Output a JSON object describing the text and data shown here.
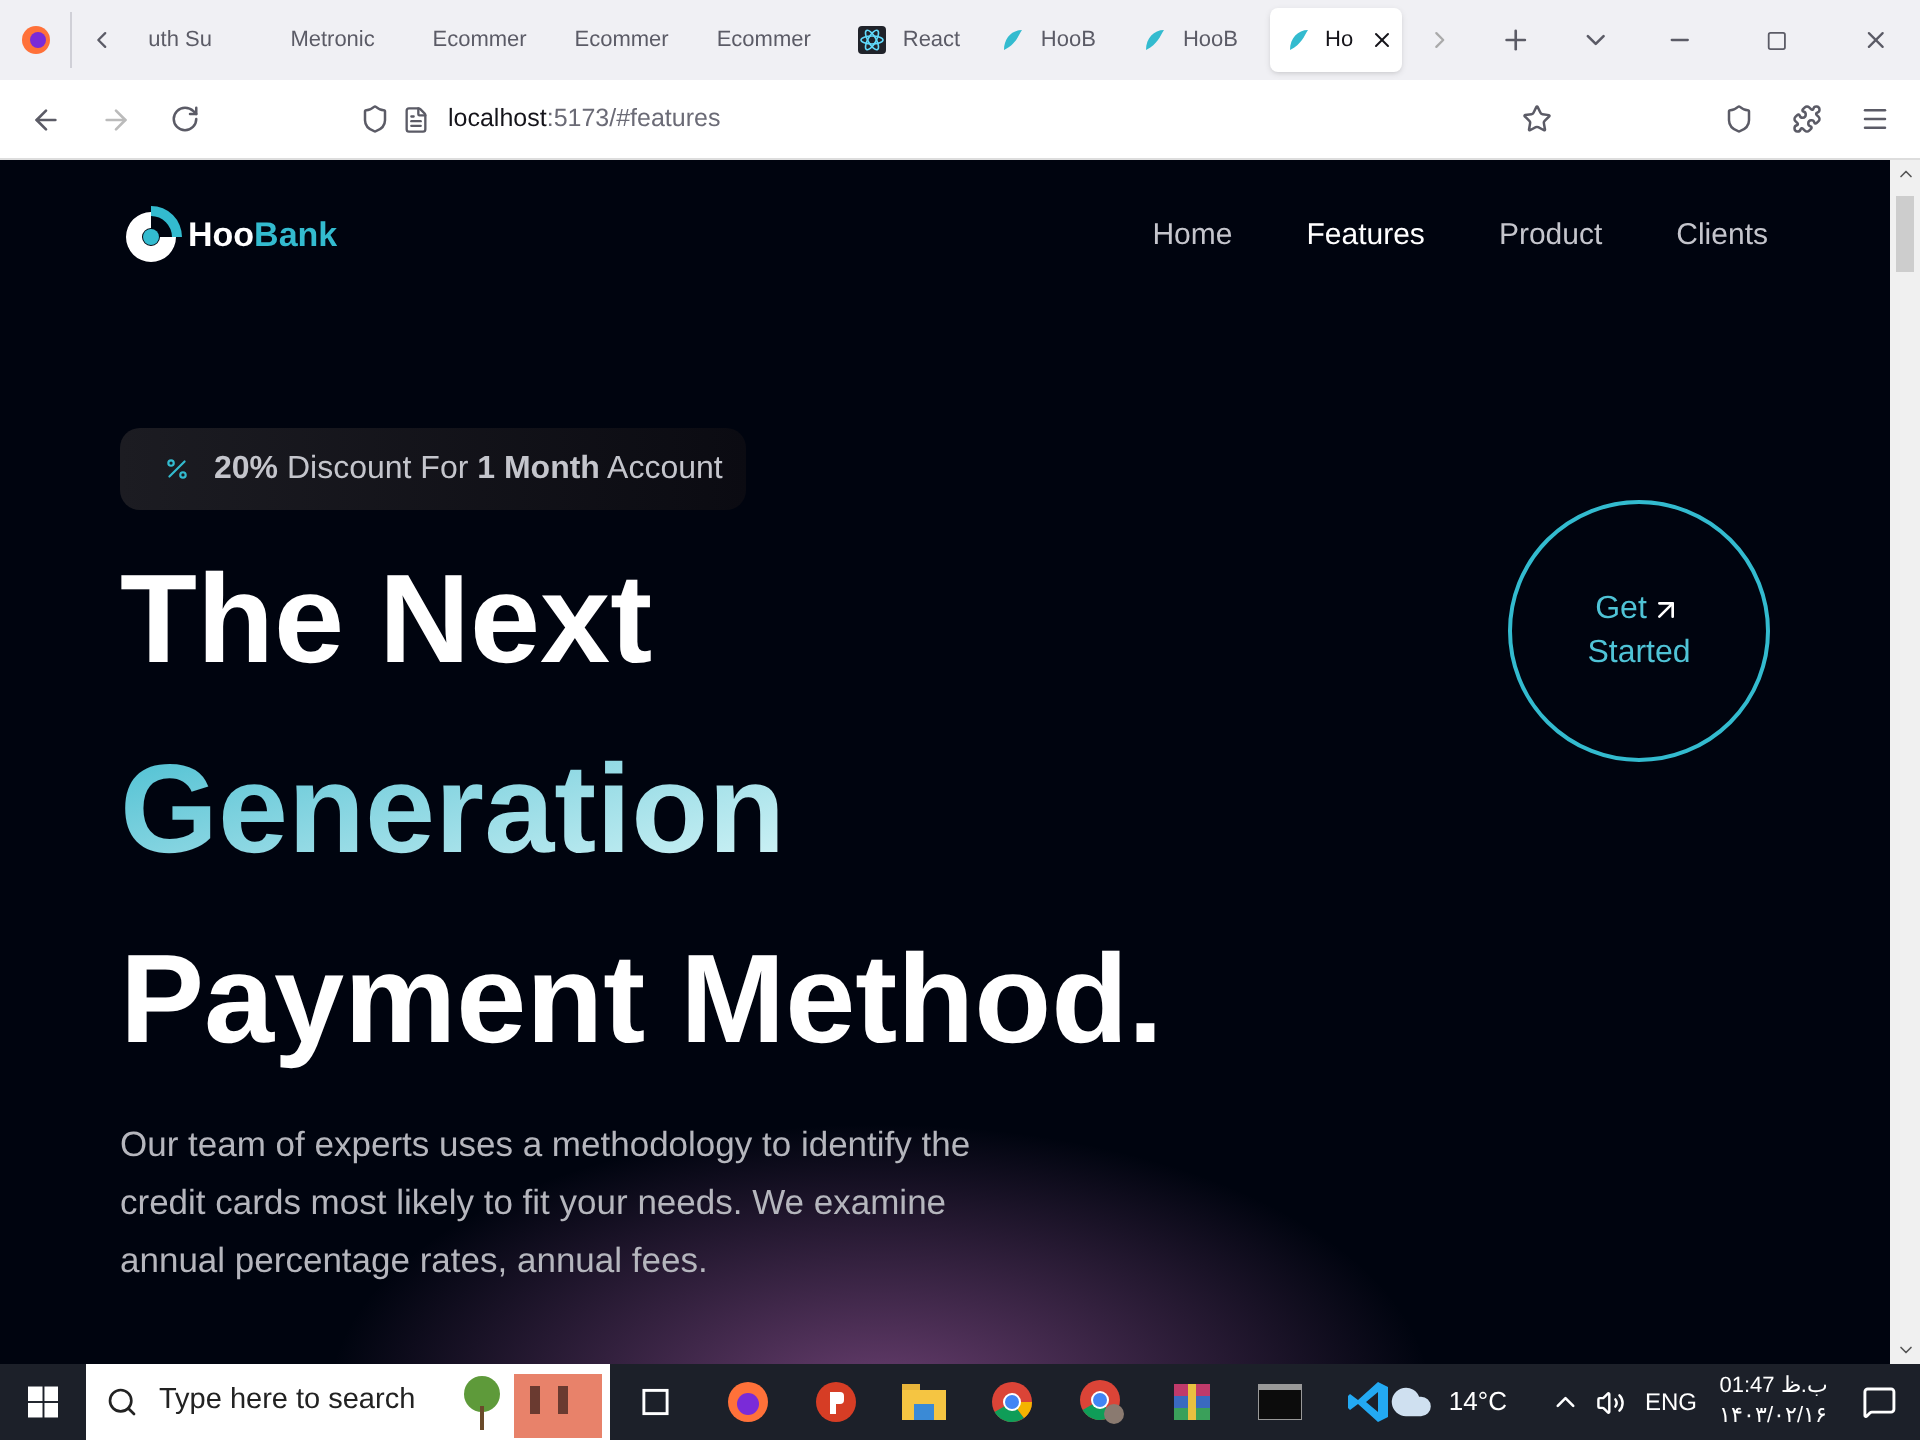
{
  "browser": {
    "tabs": [
      {
        "title": "uth Su",
        "kind": "plain",
        "selected": false
      },
      {
        "title": "Metronic",
        "kind": "plain",
        "selected": false
      },
      {
        "title": "Ecommer",
        "kind": "plain",
        "selected": false
      },
      {
        "title": "Ecommer",
        "kind": "plain",
        "selected": false
      },
      {
        "title": "Ecommer",
        "kind": "plain",
        "selected": false
      },
      {
        "title": "React",
        "kind": "atom",
        "selected": false
      },
      {
        "title": "HooB",
        "kind": "leaf",
        "selected": false
      },
      {
        "title": "HooB",
        "kind": "leaf",
        "selected": false
      },
      {
        "title": "Ho",
        "kind": "leaf",
        "selected": true
      }
    ],
    "url_host": "localhost",
    "url_path": ":5173/#features"
  },
  "page": {
    "brand": {
      "first": "Hoo",
      "second": "Bank"
    },
    "nav": [
      {
        "label": "Home",
        "selected": false
      },
      {
        "label": "Features",
        "selected": true
      },
      {
        "label": "Product",
        "selected": false
      },
      {
        "label": "Clients",
        "selected": false
      }
    ],
    "badge": "**20%** Discount For **1 Month** Account",
    "heading": [
      {
        "text": "The Next",
        "kind": "plain"
      },
      {
        "text": "Generation",
        "kind": "gradient"
      },
      {
        "text": "Payment Method.",
        "kind": "plain"
      }
    ],
    "cta": {
      "line1": "Get",
      "line2": "Started"
    },
    "description": "Our team of experts uses a methodology to identify the credit cards most likely to fit your needs. We examine annual percentage rates, annual fees."
  },
  "taskbar": {
    "search_placeholder": "Type here to search",
    "weather": "14°C",
    "language": "ENG",
    "time": "01:47 ب.ظ",
    "date": "۱۴۰۳/۰۲/۱۶"
  }
}
